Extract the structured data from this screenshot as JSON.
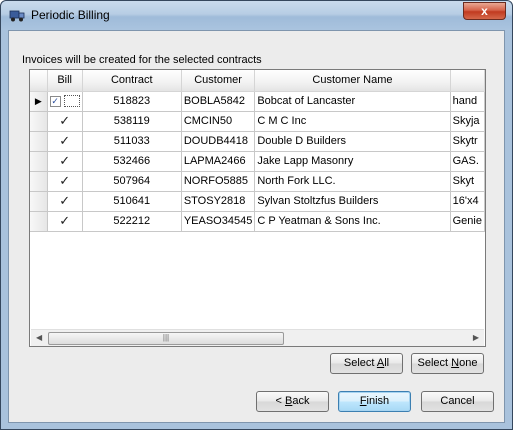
{
  "window": {
    "title": "Periodic Billing",
    "close_glyph": "x"
  },
  "caption": "Invoices will be created for the selected contracts",
  "grid": {
    "columns": [
      "Bill",
      "Contract",
      "Customer",
      "Customer Name"
    ],
    "rows": [
      {
        "current": true,
        "bill": true,
        "contract": "518823",
        "customer": "BOBLA5842",
        "name": "Bobcat of Lancaster",
        "extra": "hand"
      },
      {
        "current": false,
        "bill": true,
        "contract": "538119",
        "customer": "CMCIN50",
        "name": "C M C Inc",
        "extra": "Skyja"
      },
      {
        "current": false,
        "bill": true,
        "contract": "511033",
        "customer": "DOUDB4418",
        "name": "Double D Builders",
        "extra": "Skytr"
      },
      {
        "current": false,
        "bill": true,
        "contract": "532466",
        "customer": "LAPMA2466",
        "name": "Jake Lapp Masonry",
        "extra": "GAS."
      },
      {
        "current": false,
        "bill": true,
        "contract": "507964",
        "customer": "NORFO5885",
        "name": "North Fork LLC.",
        "extra": " Skyt"
      },
      {
        "current": false,
        "bill": true,
        "contract": "510641",
        "customer": "STOSY2818",
        "name": "Sylvan Stoltzfus Builders",
        "extra": "16'x4"
      },
      {
        "current": false,
        "bill": true,
        "contract": "522212",
        "customer": "YEASO34545",
        "name": "C P Yeatman & Sons Inc.",
        "extra": "Genie"
      }
    ]
  },
  "buttons": {
    "select_all": "Select All",
    "select_none": "Select None",
    "back": "< Back",
    "finish": "Finish",
    "cancel": "Cancel"
  }
}
